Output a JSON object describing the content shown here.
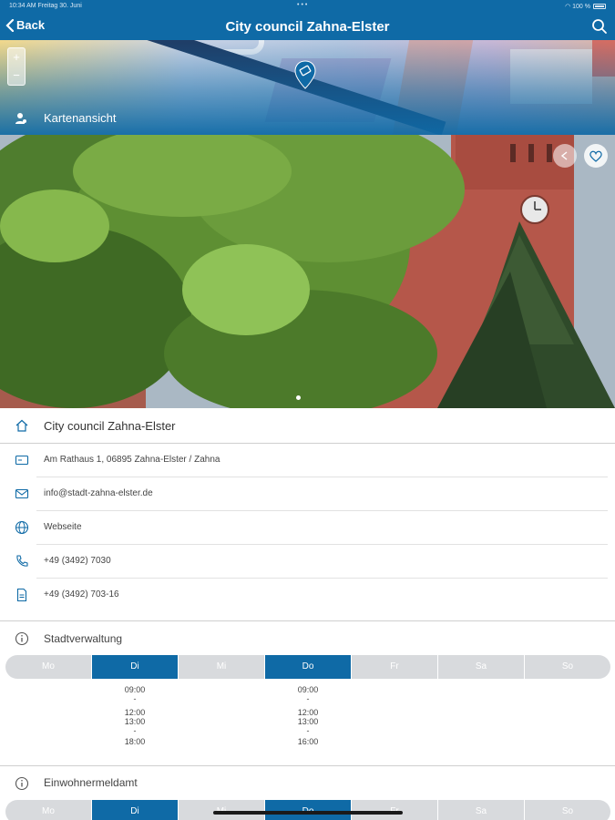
{
  "status_bar": {
    "time": "10:34 AM   Freitag 30. Juni",
    "dots": "•••",
    "battery": "100 %"
  },
  "nav": {
    "back_label": "Back",
    "title": "City council Zahna-Elster"
  },
  "map": {
    "zoom_in": "+",
    "zoom_out": "−",
    "map_view_label": "Kartenansicht"
  },
  "details": {
    "name": "City council Zahna-Elster",
    "address": "Am Rathaus 1, 06895 Zahna-Elster / Zahna",
    "email": "info@stadt-zahna-elster.de",
    "website": "Webseite",
    "phone": "+49 (3492) 7030",
    "fax": "+49 (3492) 703-16"
  },
  "sections": [
    {
      "title": "Stadtverwaltung",
      "days": [
        {
          "label": "Mo",
          "active": false
        },
        {
          "label": "Di",
          "active": true
        },
        {
          "label": "Mi",
          "active": false
        },
        {
          "label": "Do",
          "active": true
        },
        {
          "label": "Fr",
          "active": false
        },
        {
          "label": "Sa",
          "active": false
        },
        {
          "label": "So",
          "active": false
        }
      ],
      "hours": {
        "Di": [
          "09:00",
          "-",
          "12:00",
          "13:00",
          "-",
          "18:00"
        ],
        "Do": [
          "09:00",
          "-",
          "12:00",
          "13:00",
          "-",
          "16:00"
        ]
      }
    },
    {
      "title": "Einwohnermeldamt",
      "days": [
        {
          "label": "Mo",
          "active": false
        },
        {
          "label": "Di",
          "active": true
        },
        {
          "label": "Mi",
          "active": false
        },
        {
          "label": "Do",
          "active": true
        },
        {
          "label": "Fr",
          "active": false
        },
        {
          "label": "Sa",
          "active": false
        },
        {
          "label": "So",
          "active": false
        }
      ]
    }
  ],
  "colors": {
    "primary": "#0f6aa6",
    "pill": "#d8dadd"
  },
  "icons": [
    "chevron-left-icon",
    "search-icon",
    "map-pin-icon",
    "person-map-icon",
    "share-icon",
    "heart-icon",
    "home-icon",
    "address-card-icon",
    "mail-icon",
    "globe-icon",
    "phone-icon",
    "fax-document-icon",
    "info-icon"
  ]
}
